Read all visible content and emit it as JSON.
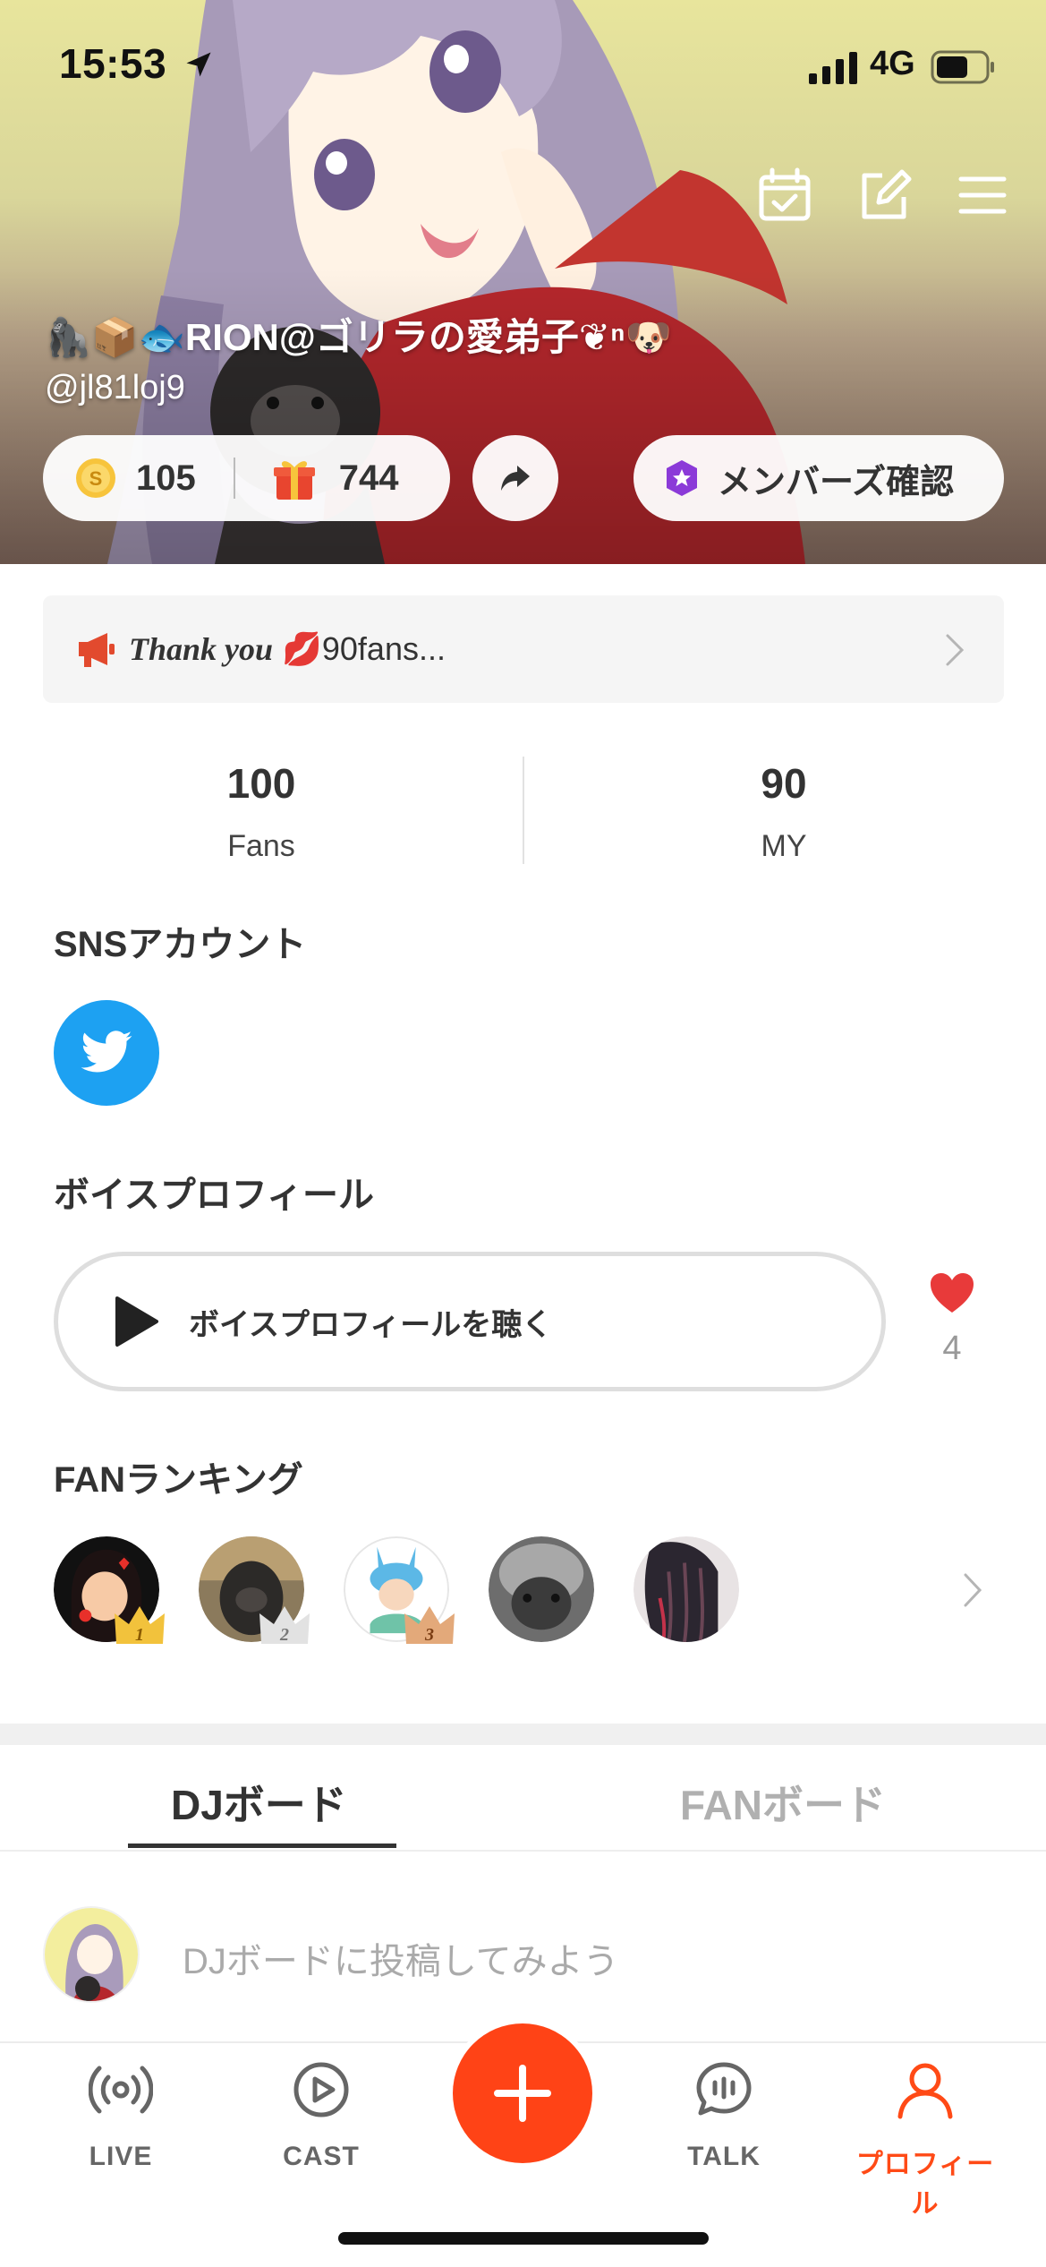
{
  "status_bar": {
    "time": "15:53",
    "network": "4G"
  },
  "profile": {
    "display_name": "🦍📦🐟RION@ゴリラの愛弟子❦ⁿ🐶",
    "handle": "@jl81loj9",
    "coins": "105",
    "gifts": "744",
    "members_button": "メンバーズ確認"
  },
  "announcement": {
    "italic": "Thank you",
    "emoji": "💋",
    "text": "90fans..."
  },
  "stats": [
    {
      "value": "100",
      "label": "Fans"
    },
    {
      "value": "90",
      "label": "MY"
    }
  ],
  "sns": {
    "title": "SNSアカウント",
    "accounts": [
      "twitter-icon"
    ]
  },
  "voice_profile": {
    "title": "ボイスプロフィール",
    "button": "ボイスプロフィールを聴く",
    "likes": "4"
  },
  "fan_ranking": {
    "title": "FANランキング",
    "ranks": [
      "1",
      "2",
      "3"
    ]
  },
  "boards": {
    "tabs": [
      "DJボード",
      "FANボード"
    ],
    "active_tab": "DJボード",
    "placeholder": "DJボードに投稿してみよう"
  },
  "bottom_nav": [
    {
      "label": "LIVE",
      "icon": "live-icon"
    },
    {
      "label": "CAST",
      "icon": "cast-icon"
    },
    {
      "label": "",
      "icon": "plus-icon"
    },
    {
      "label": "TALK",
      "icon": "talk-icon"
    },
    {
      "label": "プロフィール",
      "icon": "profile-icon",
      "active": true
    }
  ],
  "colors": {
    "accent": "#ff4316",
    "twitter": "#1da1f2",
    "heart": "#e83a3a"
  }
}
